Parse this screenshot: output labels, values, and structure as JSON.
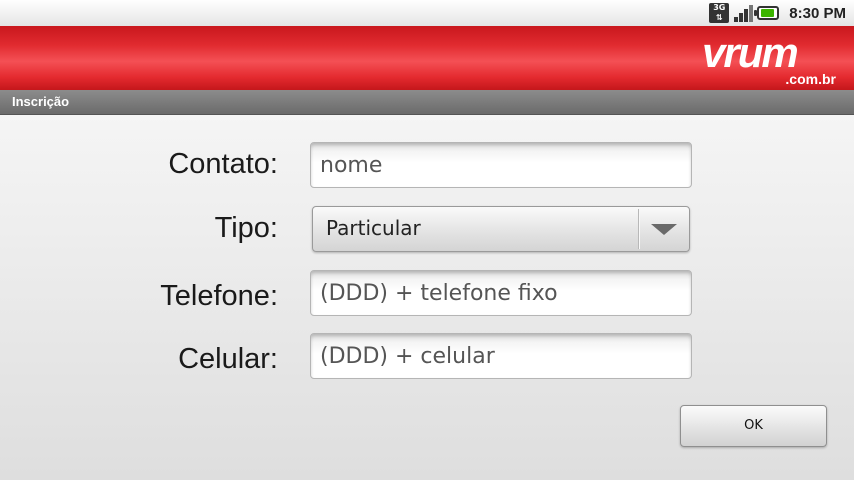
{
  "status_bar": {
    "network_type": "3G",
    "time": "8:30 PM",
    "icons": [
      "3g-icon",
      "signal-icon",
      "battery-icon"
    ]
  },
  "brand": {
    "logo_text": "vrum",
    "logo_domain": ".com.br",
    "color": "#e12b30"
  },
  "title_bar": {
    "title": "Inscrição"
  },
  "form": {
    "contato": {
      "label": "Contato:",
      "placeholder": "nome"
    },
    "tipo": {
      "label": "Tipo:",
      "value": "Particular"
    },
    "telefone": {
      "label": "Telefone:",
      "placeholder": "(DDD) + telefone fixo"
    },
    "celular": {
      "label": "Celular:",
      "placeholder": "(DDD) + celular"
    },
    "ok_label": "OK"
  }
}
